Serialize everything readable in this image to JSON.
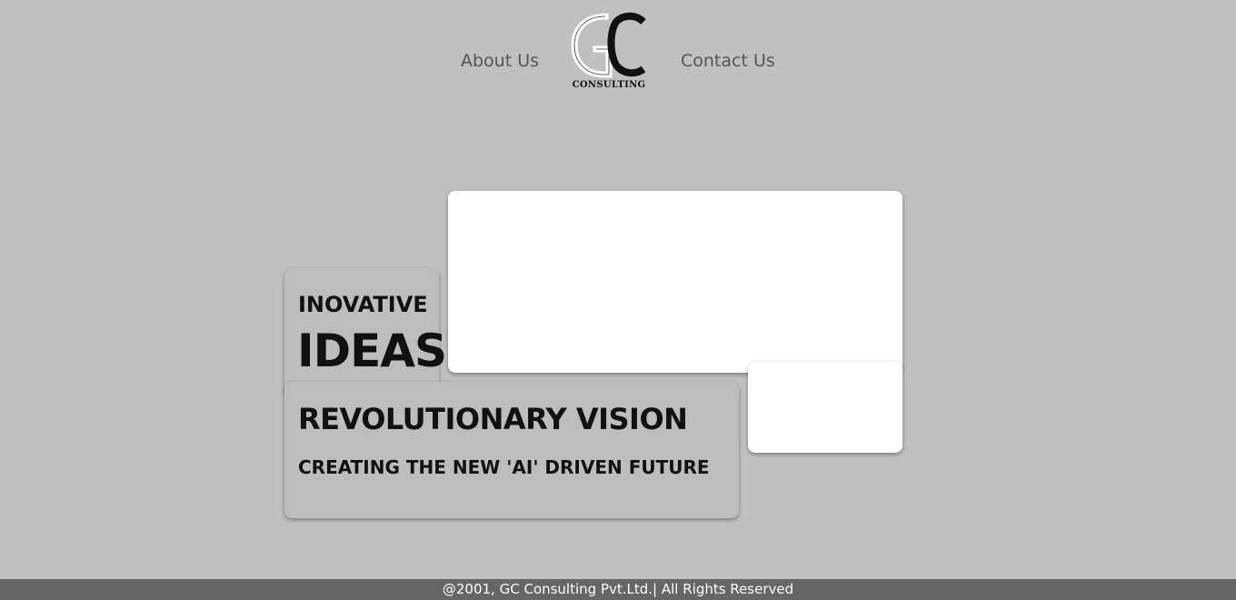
{
  "header": {
    "nav_left": "About Us",
    "nav_right": "Contact Us",
    "logo_text": "CONSULTING"
  },
  "hero": {
    "ideas_line1": "INOVATIVE",
    "ideas_line2": "IDEAS",
    "vision_title": "REVOLUTIONARY VISION",
    "vision_subtitle": "CREATING THE NEW 'AI' DRIVEN FUTURE"
  },
  "footer": {
    "text": "@2001, GC Consulting Pvt.Ltd.| All Rights Reserved"
  },
  "colors": {
    "background": "#c0c0c0",
    "footer_bg": "#666666",
    "nav_text": "#555555",
    "card_white": "#ffffff",
    "card_grey": "#bdbdbd"
  }
}
